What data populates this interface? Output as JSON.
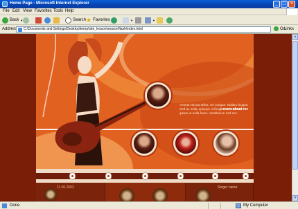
{
  "window": {
    "title": "Home Page - Microsoft Internet Explorer"
  },
  "menu": [
    "File",
    "Edit",
    "View",
    "Favorites",
    "Tools",
    "Help"
  ],
  "toolbar": {
    "back": "Back",
    "search": "Search",
    "favorites": "Favorites"
  },
  "address": {
    "label": "Address",
    "url": "C:\\Documents and Settings\\Desktop\\temp\\site_lesson\\source\\flash\\index.html",
    "go": "Go",
    "links": "Links"
  },
  "site": {
    "intro_text": "Aenean sit aut tellus, vel congue. Nullam feugiat. Sed ac nulla, quisque ut feugiat, vel molestie ipsum ut nulla fusce. Vestibulum sed nec.",
    "more_link": "» more about me",
    "date": "11.06.2003",
    "singer_label": "Singer name"
  },
  "status": {
    "left": "Done",
    "zone": "My Computer"
  },
  "colors": {
    "site_bg": "#e16120",
    "accent_dark": "#6f1d0a",
    "cream": "#f5e1cc"
  }
}
